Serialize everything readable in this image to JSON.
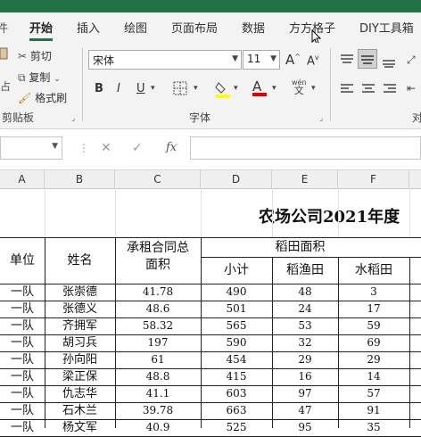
{
  "ribbon_tabs": [
    "开始",
    "插入",
    "绘图",
    "页面布局",
    "数据",
    "方方格子",
    "DIY工具箱"
  ],
  "clipboard": {
    "cut": "剪切",
    "copy": "复制",
    "format_painter": "格式刷",
    "paste_fragment": "占",
    "group_label": "剪贴板"
  },
  "font": {
    "name": "宋体",
    "size": "11",
    "group_label": "字体",
    "bold": "B",
    "italic": "I",
    "underline": "U",
    "grow": "A",
    "shrink": "A",
    "color_letter": "A",
    "phonetic": "wén",
    "fill_color": "#ffff00",
    "font_color": "#e00000"
  },
  "align_label_fragment": "对",
  "formula_bar": {
    "fx": "fx",
    "value": ""
  },
  "columns": [
    "A",
    "B",
    "C",
    "D",
    "E",
    "F"
  ],
  "sheet": {
    "title": "农场公司2021年度",
    "headers": {
      "unit": "单位",
      "name": "姓名",
      "contract_area": "承租合同总面积",
      "paddy": "稻田面积",
      "subtotal": "小计",
      "rice_fish": "稻渔田",
      "rice": "水稻田"
    },
    "rows": [
      {
        "unit": "一队",
        "name": "张崇德",
        "area": "41.78",
        "sub": "490",
        "fish": "48",
        "rice": "3"
      },
      {
        "unit": "一队",
        "name": "张德义",
        "area": "48.6",
        "sub": "501",
        "fish": "24",
        "rice": "17"
      },
      {
        "unit": "一队",
        "name": "齐拥军",
        "area": "58.32",
        "sub": "565",
        "fish": "53",
        "rice": "59"
      },
      {
        "unit": "一队",
        "name": "胡习兵",
        "area": "197",
        "sub": "590",
        "fish": "32",
        "rice": "69"
      },
      {
        "unit": "一队",
        "name": "孙向阳",
        "area": "61",
        "sub": "454",
        "fish": "29",
        "rice": "29"
      },
      {
        "unit": "一队",
        "name": "梁正保",
        "area": "48.8",
        "sub": "415",
        "fish": "16",
        "rice": "14"
      },
      {
        "unit": "一队",
        "name": "仇志华",
        "area": "41.1",
        "sub": "603",
        "fish": "97",
        "rice": "57"
      },
      {
        "unit": "一队",
        "name": "石木兰",
        "area": "39.78",
        "sub": "663",
        "fish": "47",
        "rice": "91"
      },
      {
        "unit": "一队",
        "name": "杨文军",
        "area": "40.9",
        "sub": "525",
        "fish": "95",
        "rice": "35"
      }
    ]
  }
}
